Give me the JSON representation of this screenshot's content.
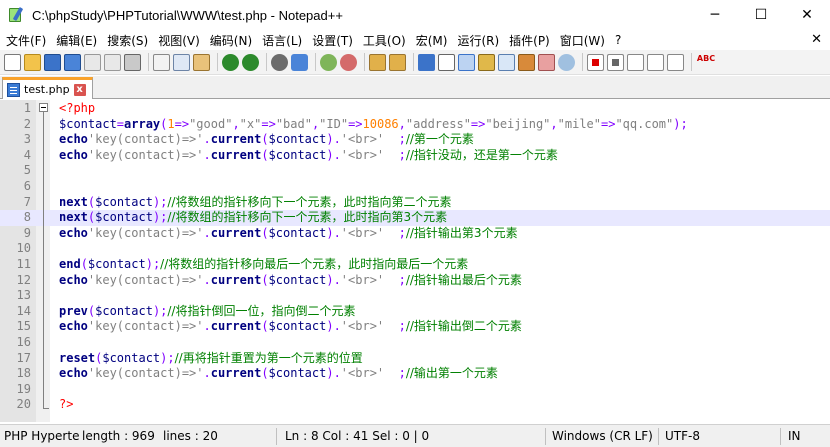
{
  "window": {
    "title": "C:\\phpStudy\\PHPTutorial\\WWW\\test.php - Notepad++",
    "minimize": "─",
    "maximize": "☐",
    "close": "✕"
  },
  "menu": {
    "items": [
      "文件(F)",
      "编辑(E)",
      "搜索(S)",
      "视图(V)",
      "编码(N)",
      "语言(L)",
      "设置(T)",
      "工具(O)",
      "宏(M)",
      "运行(R)",
      "插件(P)",
      "窗口(W)",
      "?"
    ],
    "close": "✕"
  },
  "toolbar": {
    "icons": [
      "new-file-icon",
      "open-file-icon",
      "save-icon",
      "save-all-icon",
      "close-icon",
      "close-all-icon",
      "print-icon",
      "cut-icon",
      "copy-icon",
      "paste-icon",
      "undo-icon",
      "redo-icon",
      "find-icon",
      "replace-icon",
      "zoom-in-icon",
      "zoom-out-icon",
      "sync-vertical-icon",
      "sync-horizontal-icon",
      "word-wrap-icon",
      "all-chars-icon",
      "indent-guide-icon",
      "lang-icon",
      "doc-map-icon",
      "function-list-icon",
      "folder-workspace-icon",
      "monitoring-icon",
      "record-macro-icon",
      "stop-macro-icon",
      "play-macro-icon",
      "run-macro-multiple-icon",
      "save-macro-icon"
    ],
    "spellcheck": "ABC"
  },
  "tab": {
    "label": "test.php",
    "close": "x"
  },
  "editor": {
    "current_line": 8,
    "lines": [
      {
        "n": "1",
        "t": [
          [
            "p",
            "<?php"
          ]
        ]
      },
      {
        "n": "2",
        "t": [
          [
            "v",
            "$contact"
          ],
          [
            "o",
            "="
          ],
          [
            "k",
            "array"
          ],
          [
            "o",
            "("
          ],
          [
            "n",
            "1"
          ],
          [
            "o",
            "=>"
          ],
          [
            "s",
            "\"good\""
          ],
          [
            "o",
            ","
          ],
          [
            "s",
            "\"x\""
          ],
          [
            "o",
            "=>"
          ],
          [
            "s",
            "\"bad\""
          ],
          [
            "o",
            ","
          ],
          [
            "s",
            "\"ID\""
          ],
          [
            "o",
            "=>"
          ],
          [
            "n",
            "10086"
          ],
          [
            "o",
            ","
          ],
          [
            "s",
            "\"address\""
          ],
          [
            "o",
            "=>"
          ],
          [
            "s",
            "\"beijing\""
          ],
          [
            "o",
            ","
          ],
          [
            "s",
            "\"mile\""
          ],
          [
            "o",
            "=>"
          ],
          [
            "s",
            "\"qq.com\""
          ],
          [
            "o",
            ");"
          ]
        ]
      },
      {
        "n": "3",
        "t": [
          [
            "k",
            "echo"
          ],
          [
            "s",
            "'key(contact)=>'"
          ],
          [
            "o",
            "."
          ],
          [
            "k",
            "current"
          ],
          [
            "o",
            "("
          ],
          [
            "v",
            "$contact"
          ],
          [
            "o",
            ")."
          ],
          [
            "s",
            "'<br>'"
          ],
          [
            "pb",
            "  "
          ],
          [
            "o",
            ";"
          ],
          [
            "c",
            "//第一个元素"
          ]
        ]
      },
      {
        "n": "4",
        "t": [
          [
            "k",
            "echo"
          ],
          [
            "s",
            "'key(contact)=>'"
          ],
          [
            "o",
            "."
          ],
          [
            "k",
            "current"
          ],
          [
            "o",
            "("
          ],
          [
            "v",
            "$contact"
          ],
          [
            "o",
            ")."
          ],
          [
            "s",
            "'<br>'"
          ],
          [
            "pb",
            "  "
          ],
          [
            "o",
            ";"
          ],
          [
            "c",
            "//指针没动，还是第一个元素"
          ]
        ]
      },
      {
        "n": "5",
        "t": []
      },
      {
        "n": "6",
        "t": []
      },
      {
        "n": "7",
        "t": [
          [
            "k",
            "next"
          ],
          [
            "o",
            "("
          ],
          [
            "v",
            "$contact"
          ],
          [
            "o",
            ");"
          ],
          [
            "c",
            "//将数组的指针移向下一个元素，此时指向第二个元素"
          ]
        ]
      },
      {
        "n": "8",
        "t": [
          [
            "k",
            "next"
          ],
          [
            "o",
            "("
          ],
          [
            "v",
            "$contact"
          ],
          [
            "o",
            ");"
          ],
          [
            "c",
            "//将数组的指针移向下一个元素，此时指向第3个元素"
          ]
        ]
      },
      {
        "n": "9",
        "t": [
          [
            "k",
            "echo"
          ],
          [
            "s",
            "'key(contact)=>'"
          ],
          [
            "o",
            "."
          ],
          [
            "k",
            "current"
          ],
          [
            "o",
            "("
          ],
          [
            "v",
            "$contact"
          ],
          [
            "o",
            ")."
          ],
          [
            "s",
            "'<br>'"
          ],
          [
            "pb",
            "  "
          ],
          [
            "o",
            ";"
          ],
          [
            "c",
            "//指针输出第3个元素"
          ]
        ]
      },
      {
        "n": "10",
        "t": []
      },
      {
        "n": "11",
        "t": [
          [
            "k",
            "end"
          ],
          [
            "o",
            "("
          ],
          [
            "v",
            "$contact"
          ],
          [
            "o",
            ");"
          ],
          [
            "c",
            "//将数组的指针移向最后一个元素，此时指向最后一个元素"
          ]
        ]
      },
      {
        "n": "12",
        "t": [
          [
            "k",
            "echo"
          ],
          [
            "s",
            "'key(contact)=>'"
          ],
          [
            "o",
            "."
          ],
          [
            "k",
            "current"
          ],
          [
            "o",
            "("
          ],
          [
            "v",
            "$contact"
          ],
          [
            "o",
            ")."
          ],
          [
            "s",
            "'<br>'"
          ],
          [
            "pb",
            "  "
          ],
          [
            "o",
            ";"
          ],
          [
            "c",
            "//指针输出最后个元素"
          ]
        ]
      },
      {
        "n": "13",
        "t": []
      },
      {
        "n": "14",
        "t": [
          [
            "k",
            "prev"
          ],
          [
            "o",
            "("
          ],
          [
            "v",
            "$contact"
          ],
          [
            "o",
            ");"
          ],
          [
            "c",
            "//将指针倒回一位，指向倒二个元素"
          ]
        ]
      },
      {
        "n": "15",
        "t": [
          [
            "k",
            "echo"
          ],
          [
            "s",
            "'key(contact)=>'"
          ],
          [
            "o",
            "."
          ],
          [
            "k",
            "current"
          ],
          [
            "o",
            "("
          ],
          [
            "v",
            "$contact"
          ],
          [
            "o",
            ")."
          ],
          [
            "s",
            "'<br>'"
          ],
          [
            "pb",
            "  "
          ],
          [
            "o",
            ";"
          ],
          [
            "c",
            "//指针输出倒二个元素"
          ]
        ]
      },
      {
        "n": "16",
        "t": []
      },
      {
        "n": "17",
        "t": [
          [
            "k",
            "reset"
          ],
          [
            "o",
            "("
          ],
          [
            "v",
            "$contact"
          ],
          [
            "o",
            ");"
          ],
          [
            "c",
            "//再将指针重置为第一个元素的位置"
          ]
        ]
      },
      {
        "n": "18",
        "t": [
          [
            "k",
            "echo"
          ],
          [
            "s",
            "'key(contact)=>'"
          ],
          [
            "o",
            "."
          ],
          [
            "k",
            "current"
          ],
          [
            "o",
            "("
          ],
          [
            "v",
            "$contact"
          ],
          [
            "o",
            ")."
          ],
          [
            "s",
            "'<br>'"
          ],
          [
            "pb",
            "  "
          ],
          [
            "o",
            ";"
          ],
          [
            "c",
            "//输出第一个元素"
          ]
        ]
      },
      {
        "n": "19",
        "t": []
      },
      {
        "n": "20",
        "t": [
          [
            "p",
            "?>"
          ]
        ]
      }
    ]
  },
  "status": {
    "file_type": "PHP Hyperte",
    "length": "length : 969",
    "lines": "lines : 20",
    "position": "Ln : 8    Col : 41    Sel : 0 | 0",
    "eol": "Windows (CR LF)",
    "encoding": "UTF-8",
    "mode": "IN"
  },
  "colors": {
    "keyword": "#000080",
    "string": "#808080",
    "number": "#ff8000",
    "operator": "#8000ff",
    "comment": "#008000",
    "php_tag": "#ff0000",
    "current_line": "#e8e8ff"
  }
}
